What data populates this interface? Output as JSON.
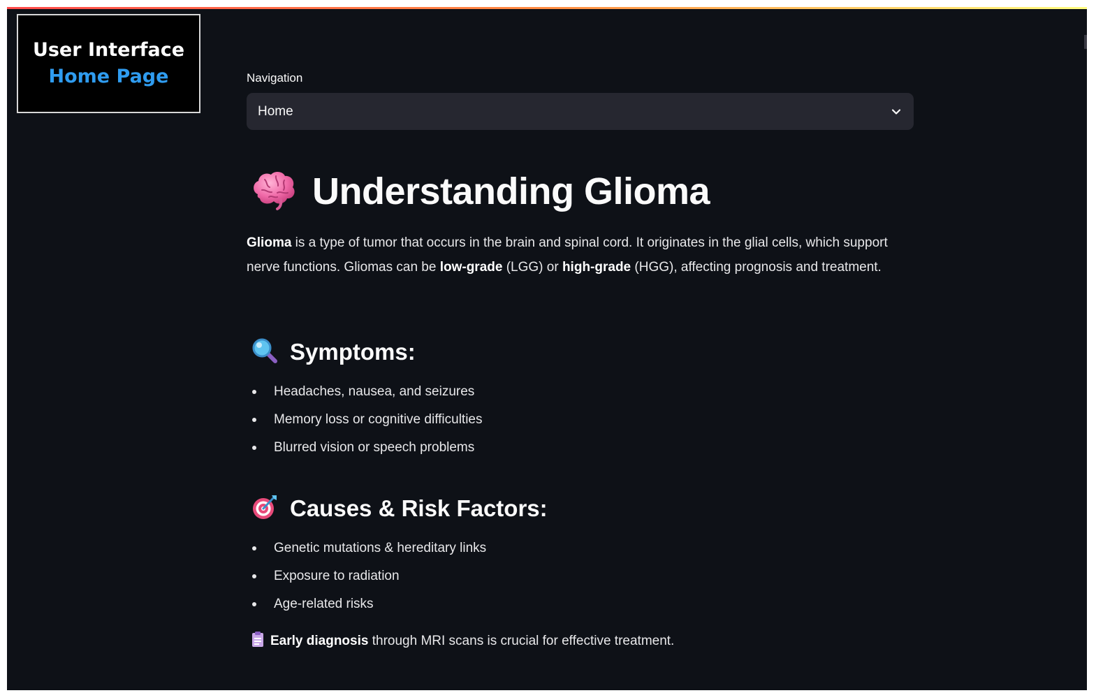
{
  "caption": {
    "line1": "User Interface",
    "line2": "Home Page"
  },
  "navigation": {
    "label": "Navigation",
    "selected": "Home"
  },
  "title": {
    "icon": "brain-icon",
    "text": "Understanding Glioma"
  },
  "intro": {
    "term": "Glioma",
    "text1": " is a type of tumor that occurs in the brain and spinal cord. It originates in the glial cells, which support nerve functions. Gliomas can be ",
    "low_grade": "low-grade",
    "text2": " (LGG) or ",
    "high_grade": "high-grade",
    "text3": " (HGG), affecting prognosis and treatment."
  },
  "symptoms": {
    "icon": "magnifying-glass-icon",
    "title": "Symptoms:",
    "items": [
      "Headaches, nausea, and seizures",
      "Memory loss or cognitive difficulties",
      "Blurred vision or speech problems"
    ]
  },
  "causes": {
    "icon": "target-icon",
    "title": "Causes & Risk Factors:",
    "items": [
      "Genetic mutations & hereditary links",
      "Exposure to radiation",
      "Age-related risks"
    ]
  },
  "footer": {
    "icon": "clipboard-icon",
    "bold": "Early diagnosis",
    "text": " through MRI scans is crucial for effective treatment."
  },
  "colors": {
    "background": "#0e1117",
    "select_bg": "#262730",
    "caption_accent": "#2f9cf0",
    "brain": "#f06aa8"
  }
}
